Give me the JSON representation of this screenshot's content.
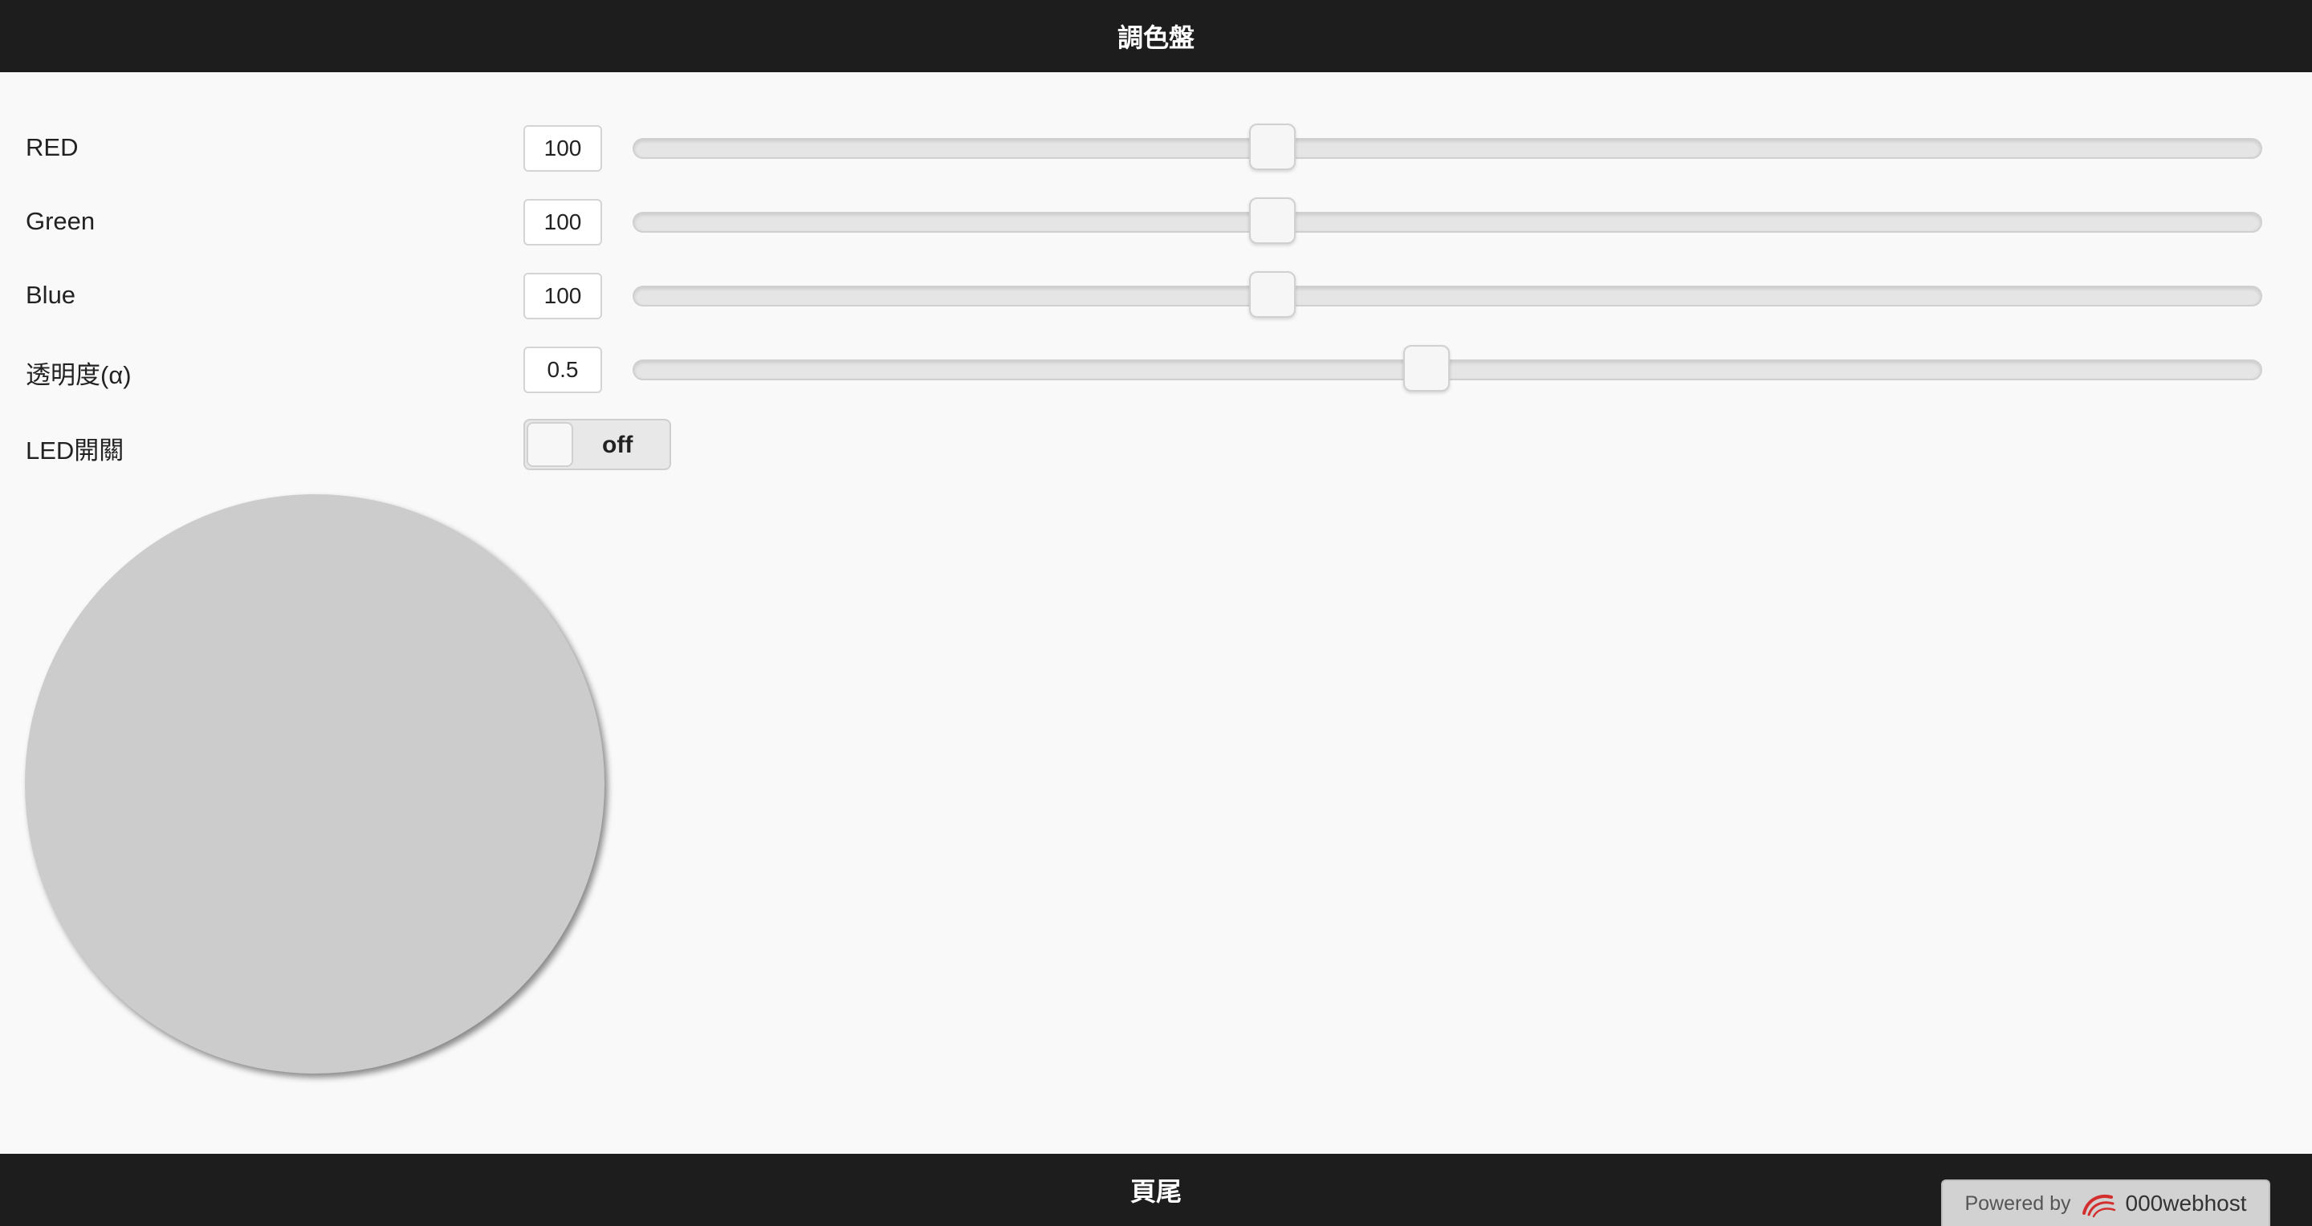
{
  "header": {
    "title": "調色盤"
  },
  "controls": {
    "red": {
      "label": "RED",
      "value": "100",
      "min": 0,
      "max": 200,
      "level": 0.5
    },
    "green": {
      "label": "Green",
      "value": "100",
      "min": 0,
      "max": 200,
      "level": 0.5
    },
    "blue": {
      "label": "Blue",
      "value": "100",
      "min": 0,
      "max": 200,
      "level": 0.5
    },
    "alpha": {
      "label": "透明度(α)",
      "value": "0.5",
      "min": 0,
      "max": 1,
      "level": 0.5
    }
  },
  "led_switch": {
    "label": "LED開關",
    "state": "off"
  },
  "led_preview": {
    "color": "#cccccc"
  },
  "footer": {
    "text": "頁尾",
    "badge": {
      "powered_by": "Powered by",
      "brand": "000webhost",
      "logo_icon": "000webhost-logo-icon"
    }
  },
  "colors": {
    "bar": "#1d1d1d",
    "background": "#f9f9f9",
    "logo_red": "#d32f2f"
  }
}
